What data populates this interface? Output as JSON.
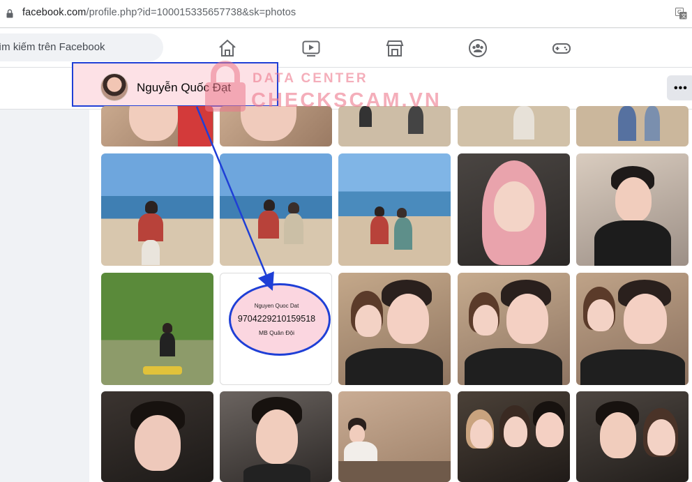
{
  "browser": {
    "url_host": "facebook.com",
    "url_path": "/profile.php?id=100015335657738&sk=photos",
    "icons": {
      "lock": "lock-icon",
      "translate": "translate-icon"
    }
  },
  "topbar": {
    "search_text": "ìm kiếm trên Facebook",
    "nav_icons": [
      "home-icon",
      "watch-icon",
      "marketplace-icon",
      "groups-icon",
      "gaming-icon"
    ]
  },
  "profile": {
    "name": "Nguyễn Quốc Đạt",
    "more_label": "•••"
  },
  "watermark": {
    "line1": "DATA CENTER",
    "line2": "CHECKSCAM.VN"
  },
  "bank_card": {
    "account_name": "Nguyen Quoc Dat",
    "account_number": "9704229210159518",
    "bank": "MB Quân Đội"
  },
  "colors": {
    "highlight_border": "#1f3fd6",
    "highlight_fill": "#fde1e6",
    "watermark": "#ec788c",
    "fb_bg": "#f0f2f5"
  }
}
